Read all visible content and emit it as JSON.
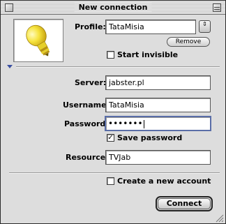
{
  "window": {
    "title": "New connection"
  },
  "profile": {
    "label": "Profile:",
    "value": "TataMisia",
    "popup_glyph": "⇕",
    "remove_label": "Remove"
  },
  "start_invisible": {
    "label": "Start invisible",
    "checked": false
  },
  "server": {
    "label": "Server:",
    "value": "jabster.pl"
  },
  "username": {
    "label": "Username:",
    "value": "TataMisia"
  },
  "password": {
    "label": "Password:",
    "value": "•••••••"
  },
  "save_password": {
    "label": "Save password",
    "checked": true
  },
  "resource": {
    "label": "Resource:",
    "value": "TVJab"
  },
  "create_account": {
    "label": "Create a new account",
    "checked": false
  },
  "buttons": {
    "connect_label": "Connect"
  },
  "icons": {
    "profile_icon": "lightbulb-icon",
    "accent": "#3a4fa0",
    "bulb_color": "#f3e03a"
  }
}
